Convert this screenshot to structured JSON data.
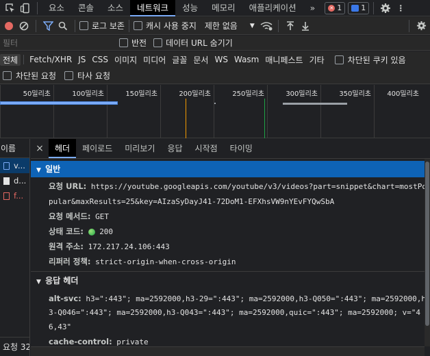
{
  "tabs": {
    "items": [
      "요소",
      "콘솔",
      "소스",
      "네트워크",
      "성능",
      "메모리",
      "애플리케이션"
    ],
    "active": "네트워크",
    "more": "»",
    "error_count": "1",
    "message_count": "1"
  },
  "toolbar": {
    "preserve_log": "로그 보존",
    "disable_cache": "캐시 사용 중지",
    "throttle": "제한 없음"
  },
  "filter": {
    "placeholder": "필터",
    "invert": "반전",
    "hide_data_urls": "데이터 URL 숨기기"
  },
  "types": [
    "전체",
    "Fetch/XHR",
    "JS",
    "CSS",
    "이미지",
    "미디어",
    "글꼴",
    "문서",
    "WS",
    "Wasm",
    "매니페스트",
    "기타"
  ],
  "blocked_cookies": "차단된 쿠키 있음",
  "blocked_requests": "차단된 요청",
  "third_party": "타사 요청",
  "overview": {
    "ticks": [
      "50밀리초",
      "100밀리초",
      "150밀리초",
      "200밀리초",
      "250밀리초",
      "300밀리초",
      "350밀리초",
      "400밀리초"
    ]
  },
  "list": {
    "header": "이름",
    "rows": [
      "v...",
      "d...",
      "f..."
    ],
    "status": "요청 32"
  },
  "detail": {
    "close": "×",
    "tabs": [
      "헤더",
      "페이로드",
      "미리보기",
      "응답",
      "시작점",
      "타이밍"
    ],
    "active_tab": "헤더",
    "general_title": "일반",
    "request_url_label": "요청 URL:",
    "request_url_line1": "https://youtube.googleapis.com/youtube/v3/videos?part=snippet&chart=mostPo",
    "request_url_line2": "pular&maxResults=25&key=AIzaSyDayJ41-72DoM1-EFXhsVW9nYEvFYQwSbA",
    "method_label": "요청 메서드:",
    "method": "GET",
    "status_label": "상태 코드:",
    "status": "200",
    "remote_label": "원격 주소:",
    "remote": "172.217.24.106:443",
    "referrer_label": "리퍼러 정책:",
    "referrer": "strict-origin-when-cross-origin",
    "response_title": "응답 헤더",
    "altsvc_label": "alt-svc:",
    "altsvc_line1": "h3=\":443\"; ma=2592000,h3-29=\":443\"; ma=2592000,h3-Q050=\":443\"; ma=2592000,h",
    "altsvc_line2": "3-Q046=\":443\"; ma=2592000,h3-Q043=\":443\"; ma=2592000,quic=\":443\"; ma=2592000; v=\"4",
    "altsvc_line3": "6,43\"",
    "cache_label": "cache-control:",
    "cache": "private"
  }
}
